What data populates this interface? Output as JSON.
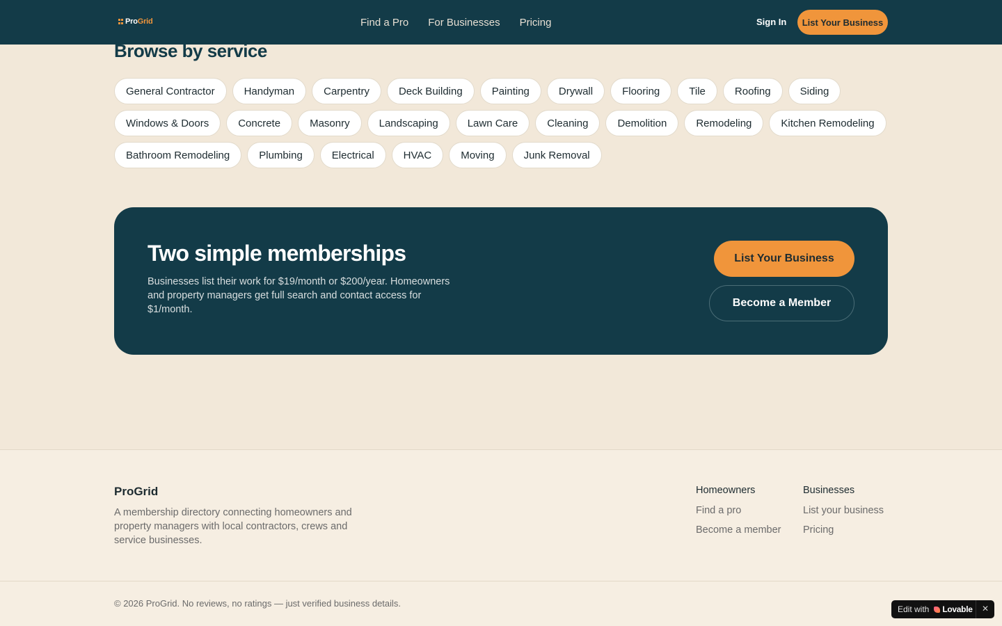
{
  "header": {
    "logo_text": "Pro",
    "logo_accent": "Grid",
    "nav": [
      "Find a Pro",
      "For Businesses",
      "Pricing"
    ],
    "sign_in": "Sign In",
    "list_business": "List Your Business"
  },
  "browse": {
    "title": "Browse by service",
    "rows": [
      [
        "General Contractor",
        "Handyman",
        "Carpentry",
        "Deck Building",
        "Painting",
        "Drywall",
        "Flooring",
        "Tile",
        "Roofing",
        "Siding"
      ],
      [
        "Windows & Doors",
        "Concrete",
        "Masonry",
        "Landscaping",
        "Lawn Care",
        "Cleaning",
        "Demolition",
        "Remodeling",
        "Kitchen Remodeling"
      ],
      [
        "Bathroom Remodeling",
        "Plumbing",
        "Electrical",
        "HVAC",
        "Moving",
        "Junk Removal"
      ]
    ]
  },
  "cta": {
    "title": "Two simple memberships",
    "text": "Businesses list their work for $19/month or $200/year. Homeowners and property managers get full search and contact access for $1/month.",
    "primary": "List Your Business",
    "secondary": "Become a Member"
  },
  "footer": {
    "brand": "ProGrid",
    "description": "A membership directory connecting homeowners and property managers with local contractors, crews and service businesses.",
    "homeowners": {
      "title": "Homeowners",
      "links": [
        "Find a pro",
        "Become a member"
      ]
    },
    "businesses": {
      "title": "Businesses",
      "links": [
        "List your business",
        "Pricing"
      ]
    },
    "copyright": "© 2026 ProGrid. No reviews, no ratings — just verified business details."
  },
  "badge": {
    "edit": "Edit with",
    "brand": "Lovable",
    "close": "✕"
  },
  "colors": {
    "header_bg": "#133b48",
    "accent": "#f0953b",
    "page_bg": "#f2e8d9"
  }
}
